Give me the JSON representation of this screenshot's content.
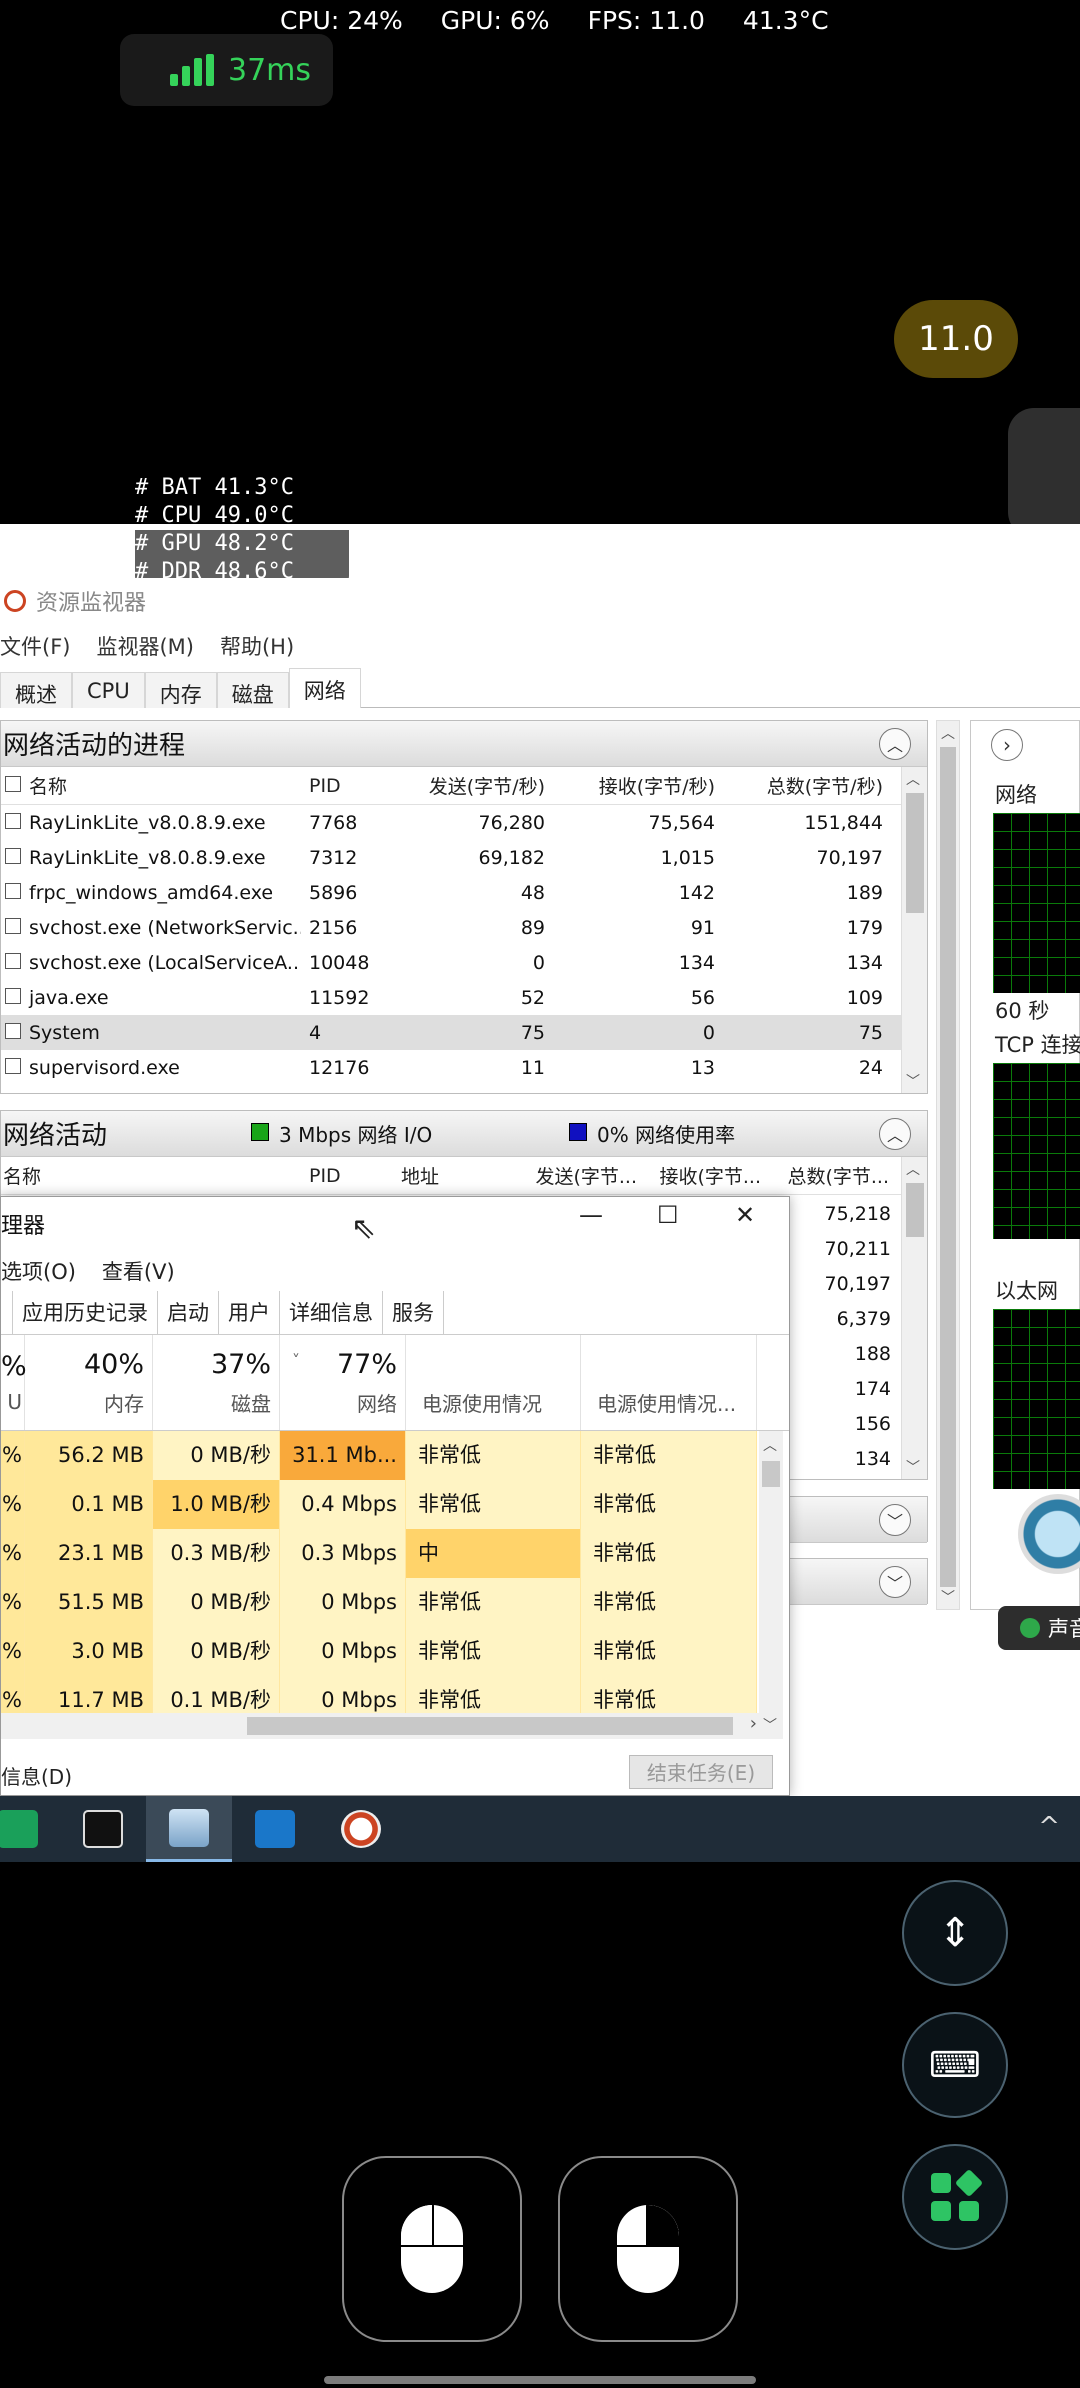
{
  "overlay": {
    "cpu": "CPU: 24%",
    "gpu": "GPU: 6%",
    "fps": "FPS: 11.0",
    "temp": "41.3°C",
    "ping": "37ms",
    "fps_badge": "11.0",
    "temps": [
      "# BAT 41.3°C",
      "# CPU 49.0°C",
      "# GPU 48.2°C",
      "# DDR 48.6°C"
    ]
  },
  "resmon": {
    "title": "资源监视器",
    "menu": [
      "文件(F)",
      "监视器(M)",
      "帮助(H)"
    ],
    "tabs": [
      "概述",
      "CPU",
      "内存",
      "磁盘",
      "网络"
    ],
    "active_tab": "网络",
    "proc_panel": {
      "title": "网络活动的进程",
      "headers": [
        "名称",
        "PID",
        "发送(字节/秒)",
        "接收(字节/秒)",
        "总数(字节/秒)"
      ],
      "rows": [
        [
          "RayLinkLite_v8.0.8.9.exe",
          "7768",
          "76,280",
          "75,564",
          "151,844"
        ],
        [
          "RayLinkLite_v8.0.8.9.exe",
          "7312",
          "69,182",
          "1,015",
          "70,197"
        ],
        [
          "frpc_windows_amd64.exe",
          "5896",
          "48",
          "142",
          "189"
        ],
        [
          "svchost.exe (NetworkServic...",
          "2156",
          "89",
          "91",
          "179"
        ],
        [
          "svchost.exe (LocalServiceA...",
          "10048",
          "0",
          "134",
          "134"
        ],
        [
          "java.exe",
          "11592",
          "52",
          "56",
          "109"
        ],
        [
          "System",
          "4",
          "75",
          "0",
          "75"
        ],
        [
          "supervisord.exe",
          "12176",
          "11",
          "13",
          "24"
        ]
      ]
    },
    "net_panel": {
      "title": "网络活动",
      "io_label": "3 Mbps 网络 I/O",
      "usage_label": "0% 网络使用率",
      "headers": [
        "名称",
        "PID",
        "地址",
        "发送(字节...",
        "接收(字节...",
        "总数(字节..."
      ],
      "totals": [
        "75,218",
        "70,211",
        "70,197",
        "6,379",
        "188",
        "174",
        "156",
        "134"
      ]
    },
    "right": {
      "net": "网络",
      "sec": "60 秒",
      "tcp": "TCP 连接",
      "eth": "以太网"
    },
    "toast": "声音"
  },
  "taskmgr": {
    "title": "理器",
    "menu": [
      "选项(O)",
      "查看(V)"
    ],
    "tabs": [
      "应用历史记录",
      "启动",
      "用户",
      "详细信息",
      "服务"
    ],
    "head": {
      "cpu_pct": "%",
      "cpu_name": "U",
      "mem_pct": "40%",
      "mem_name": "内存",
      "disk_pct": "37%",
      "disk_name": "磁盘",
      "net_pct": "77%",
      "net_name": "网络",
      "power": "电源使用情况",
      "power_trend": "电源使用情况..."
    },
    "rows": [
      [
        "%",
        "56.2 MB",
        "0 MB/秒",
        "31.1 Mb...",
        "非常低",
        "非常低"
      ],
      [
        "%",
        "0.1 MB",
        "1.0 MB/秒",
        "0.4 Mbps",
        "非常低",
        "非常低"
      ],
      [
        "%",
        "23.1 MB",
        "0.3 MB/秒",
        "0.3 Mbps",
        "中",
        "非常低"
      ],
      [
        "%",
        "51.5 MB",
        "0 MB/秒",
        "0 Mbps",
        "非常低",
        "非常低"
      ],
      [
        "%",
        "3.0 MB",
        "0 MB/秒",
        "0 Mbps",
        "非常低",
        "非常低"
      ],
      [
        "%",
        "11.7 MB",
        "0.1 MB/秒",
        "0 Mbps",
        "非常低",
        "非常低"
      ]
    ],
    "footer_left": "信息(D)",
    "end_task": "结束任务(E)"
  },
  "colors": {
    "ping_green": "#35d35a",
    "fps_badge": "#5b4a08",
    "taskbar": "#1f2c38",
    "heat_high": "#f9a93b",
    "heat_mid": "#ffd36a"
  }
}
